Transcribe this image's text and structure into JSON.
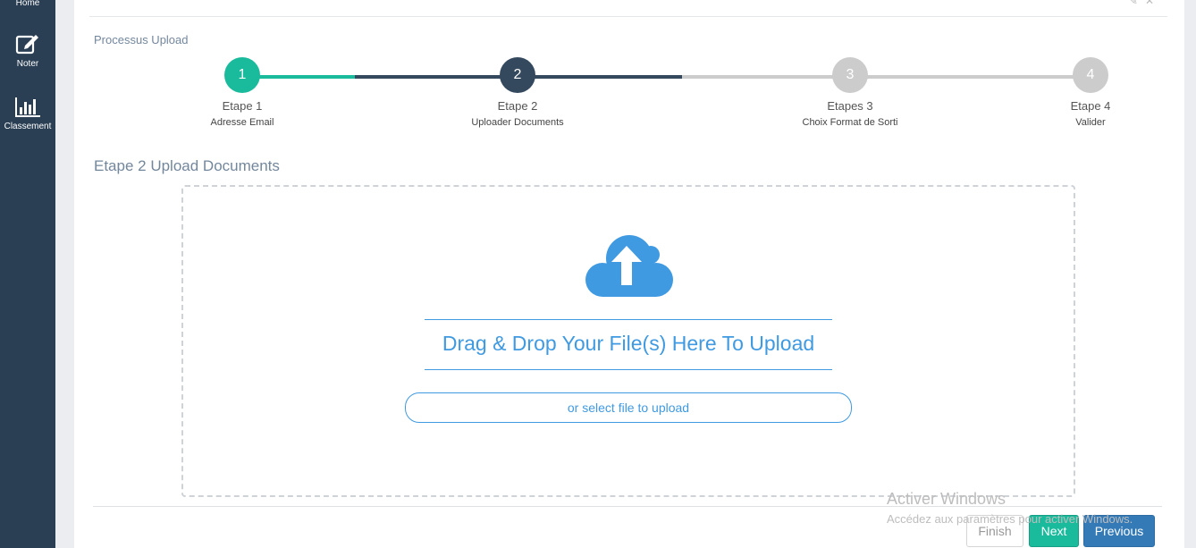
{
  "sidebar": {
    "items": [
      {
        "label": "Home",
        "icon": "home-icon"
      },
      {
        "label": "Noter",
        "icon": "edit-icon"
      },
      {
        "label": "Classement",
        "icon": "bar-chart-icon"
      }
    ]
  },
  "process": {
    "title": "Processus Upload",
    "steps": [
      {
        "number": "1",
        "name": "Etape 1",
        "desc": "Adresse Email",
        "state": "done",
        "color": "#1abb9c"
      },
      {
        "number": "2",
        "name": "Etape 2",
        "desc": "Uploader Documents",
        "state": "current",
        "color": "#34495e"
      },
      {
        "number": "3",
        "name": "Etapes 3",
        "desc": "Choix Format de Sorti",
        "state": "pending",
        "color": "#cccccc"
      },
      {
        "number": "4",
        "name": "Etape 4",
        "desc": "Valider",
        "state": "pending",
        "color": "#cccccc"
      }
    ]
  },
  "section": {
    "title": "Etape 2 Upload Documents"
  },
  "dropzone": {
    "drag_text": "Drag & Drop Your File(s) Here To Upload",
    "select_text": "or select file to upload",
    "icon": "cloud-upload-icon",
    "accent": "#3f9ae2"
  },
  "buttons": {
    "finish": "Finish",
    "next": "Next",
    "previous": "Previous"
  },
  "watermark": {
    "title": "Activer Windows",
    "subtitle": "Accédez aux paramètres pour activer Windows."
  }
}
